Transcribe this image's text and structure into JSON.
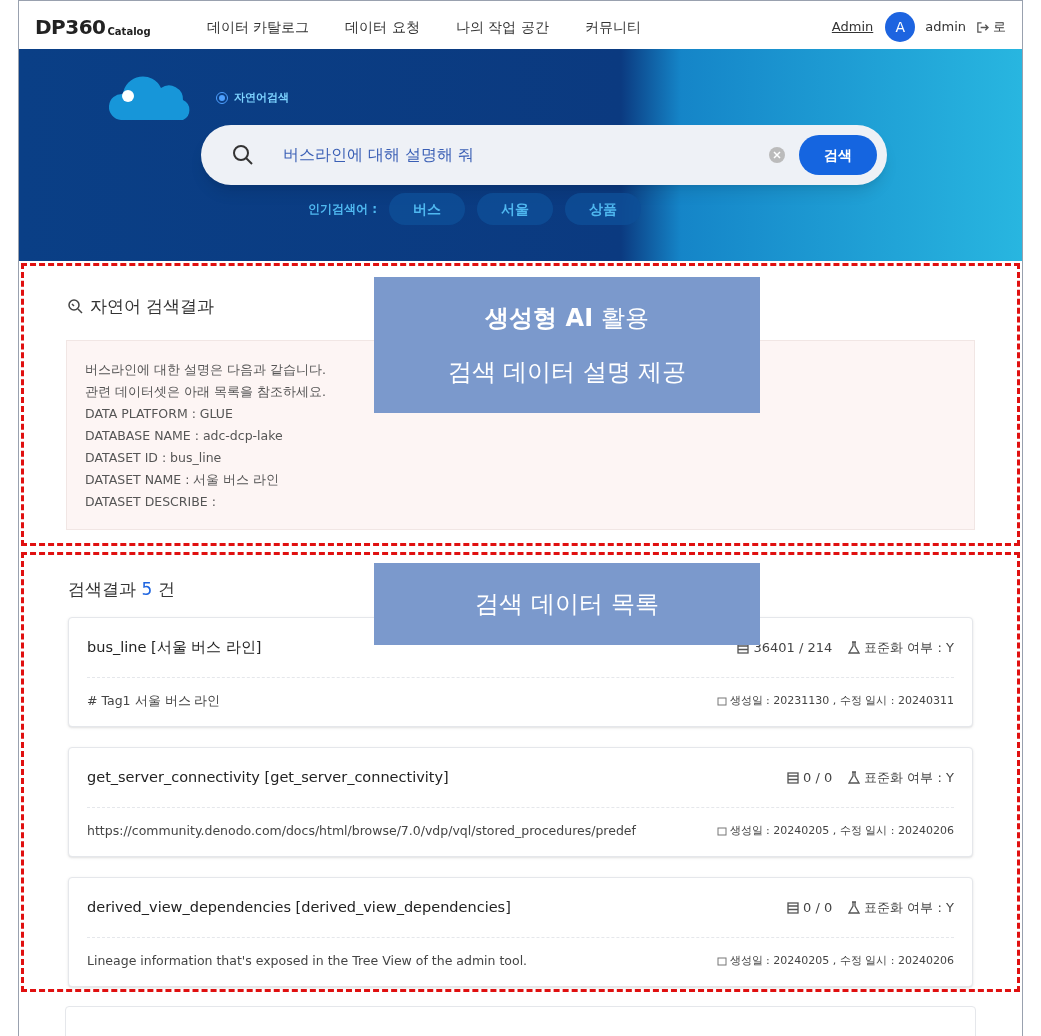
{
  "header": {
    "logo": {
      "main": "DP360",
      "sub": "Catalog"
    },
    "menu": [
      "데이터 카탈로그",
      "데이터 요청",
      "나의 작업 공간",
      "커뮤니티"
    ],
    "admin_link": "Admin",
    "avatar": "A",
    "username": "admin",
    "logout": "로"
  },
  "hero": {
    "search_mode": {
      "label": "자연어검색",
      "selected": true
    },
    "search": {
      "value": "버스라인에 대해 설명해 줘",
      "button": "검색"
    },
    "popular_label": "인기검색어 :",
    "popular_tags": [
      "버스",
      "서울",
      "상품"
    ]
  },
  "ai_result": {
    "title": "자연어 검색결과",
    "lines": [
      "버스라인에 대한 설명은 다음과 같습니다.",
      "관련 데이터셋은 아래 목록을 참조하세요.",
      "DATA PLATFORM : GLUE",
      "DATABASE NAME : adc-dcp-lake",
      "DATASET ID : bus_line",
      "DATASET NAME : 서울 버스 라인",
      "DATASET DESCRIBE :"
    ],
    "annotation": [
      "**생성형 AI** 활용",
      "검색 데이터 설명 제공"
    ]
  },
  "results": {
    "label": "검색결과",
    "count": "5",
    "unit": "건",
    "annotation": [
      "검색 데이터 목록"
    ],
    "items": [
      {
        "title": "bus_line [서울 버스 라인]",
        "stats": "36401 / 214",
        "standard": "표준화 여부 : Y",
        "description": "# Tag1 서울 버스 라인",
        "dates": "생성일 : 20231130 , 수정 일시 : 20240311"
      },
      {
        "title": "get_server_connectivity [get_server_connectivity]",
        "stats": "0 / 0",
        "standard": "표준화 여부 : Y",
        "description": "https://community.denodo.com/docs/html/browse/7.0/vdp/vql/stored_procedures/predef",
        "dates": "생성일 : 20240205 , 수정 일시 : 20240206"
      },
      {
        "title": "derived_view_dependencies [derived_view_dependencies]",
        "stats": "0 / 0",
        "standard": "표준화 여부 : Y",
        "description": "Lineage information that's exposed in the Tree View of the admin tool.",
        "dates": "생성일 : 20240205 , 수정 일시 : 20240206"
      }
    ]
  }
}
